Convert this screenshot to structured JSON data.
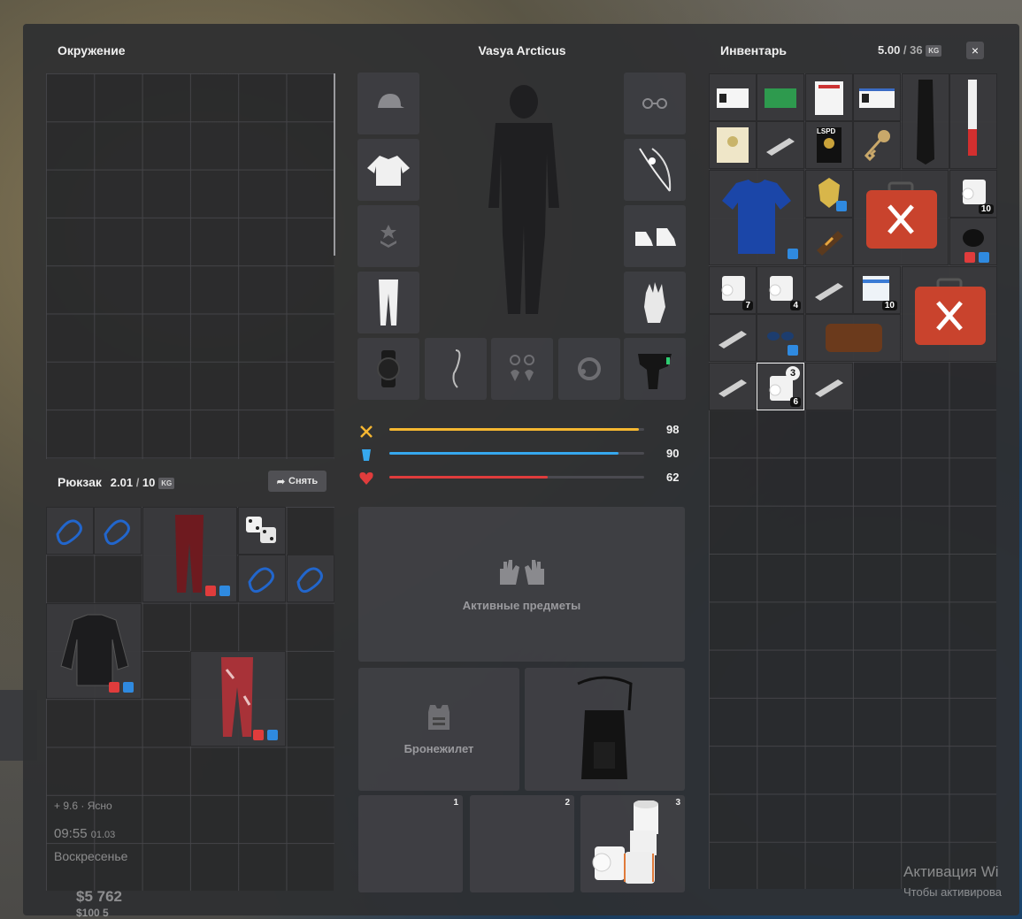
{
  "environment": {
    "title": "Окружение"
  },
  "character": {
    "name": "Vasya Arcticus"
  },
  "inventory": {
    "title": "Инвентарь",
    "weight": "5.00",
    "capacity": "36",
    "unit": "KG",
    "close_label": "×"
  },
  "backpack": {
    "title": "Рюкзак",
    "weight": "2.01",
    "capacity": "10",
    "unit": "KG",
    "remove_label": "Снять"
  },
  "stats": [
    {
      "name": "food",
      "value": 98,
      "color": "#f5b731"
    },
    {
      "name": "water",
      "value": 90,
      "color": "#36a8ee"
    },
    {
      "name": "health",
      "value": 62,
      "color": "#e03c3c"
    }
  ],
  "active_items": {
    "label": "Активные предметы"
  },
  "armor": {
    "label": "Бронежилет"
  },
  "hotbar": [
    {
      "number": "1"
    },
    {
      "number": "2"
    },
    {
      "number": "3"
    }
  ],
  "item_counts": {
    "roll_a": "10",
    "roll_b": "7",
    "roll_c": "4",
    "pills": "10",
    "roll_selected_top": "3",
    "roll_selected_bottom": "6"
  },
  "id_card": {
    "label": "LSPD"
  },
  "hud": {
    "temp": "+ 9.6",
    "weather": "Ясно",
    "time": "09:55",
    "date": "01.03",
    "day": "Воскресенье",
    "money": "$5 762",
    "money2": "$100 5"
  },
  "watermark": {
    "line1": "Активация Wi",
    "line2": "Чтобы активирова"
  }
}
